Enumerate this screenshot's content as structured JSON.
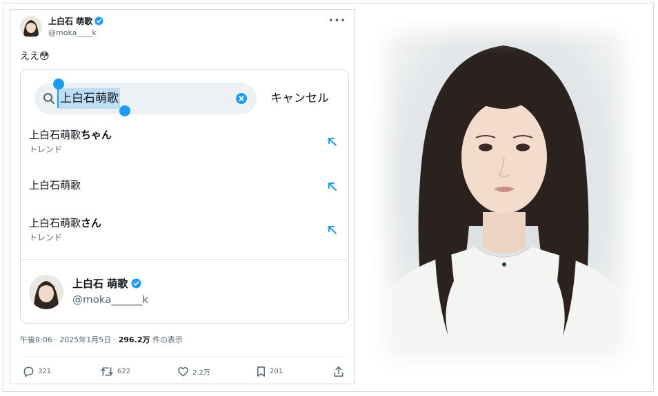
{
  "tweet": {
    "author_name": "上白石 萌歌",
    "author_handle": "@moka____k",
    "text": "ええ😳",
    "embed": {
      "search_value": "上白石萌歌",
      "cancel_label": "キャンセル",
      "suggestions": [
        {
          "prefix": "上白石萌歌",
          "suffix": "ちゃん",
          "sub": "トレンド"
        },
        {
          "prefix": "上白石萌歌",
          "suffix": "",
          "sub": ""
        },
        {
          "prefix": "上白石萌歌",
          "suffix": "さん",
          "sub": "トレンド"
        }
      ],
      "user_result": {
        "name": "上白石 萌歌",
        "handle": "@moka______k"
      }
    },
    "meta": {
      "time": "午後8:06",
      "date": "2025年1月5日",
      "views": "296.2万",
      "views_label": "件の表示"
    },
    "actions": {
      "replies": "321",
      "reposts": "622",
      "likes": "2.2万",
      "bookmarks": "201"
    }
  },
  "colors": {
    "accent": "#1d9bf0",
    "text": "#0f1419",
    "muted": "#536471"
  },
  "icons": [
    "more-icon",
    "verified-badge-icon",
    "search-icon",
    "clear-icon",
    "arrow-up-left-icon",
    "reply-icon",
    "repost-icon",
    "like-icon",
    "bookmark-icon",
    "share-icon"
  ]
}
